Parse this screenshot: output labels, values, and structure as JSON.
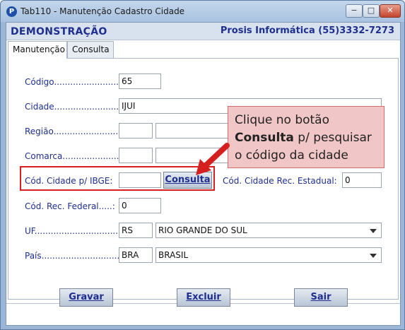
{
  "window": {
    "title": "Tab110 - Manutenção Cadastro Cidade",
    "app_icon_letter": "P",
    "controls": {
      "minimize": "−",
      "maximize": "□",
      "close": "✕"
    }
  },
  "header": {
    "left": "DEMONSTRAÇÃO",
    "right": "Prosis Informática (55)3332-7273"
  },
  "tabs": [
    {
      "label": "Manutenção",
      "active": true
    },
    {
      "label": "Consulta",
      "active": false
    }
  ],
  "form": {
    "codigo": {
      "label": "Código.........................:",
      "value": "65"
    },
    "cidade": {
      "label": "Cidade...........................:",
      "value": "IJUI"
    },
    "regiao": {
      "label": "Região...........................:",
      "value": "",
      "desc": ""
    },
    "comarca": {
      "label": "Comarca.......................:",
      "value": "",
      "desc": ""
    },
    "ibge": {
      "label": "Cód. Cidade p/ IBGE:",
      "value": "",
      "button": "Consulta"
    },
    "rec_estadual": {
      "label": "Cód. Cidade Rec. Estadual:",
      "value": "0"
    },
    "rec_federal": {
      "label": "Cód. Rec. Federal.....:",
      "value": "0"
    },
    "uf": {
      "label": "UF..................................:",
      "code": "RS",
      "name": "RIO GRANDE DO SUL"
    },
    "pais": {
      "label": "País...............................:",
      "code": "BRA",
      "name": "BRASIL"
    }
  },
  "buttons": {
    "gravar": "Gravar",
    "excluir": "Excluir",
    "sair": "Sair"
  },
  "callout": {
    "line1": "Clique no botão",
    "bold": "Consulta",
    "line2_rest": " p/ pesquisar",
    "line3": "o código da cidade"
  },
  "colors": {
    "label_blue": "#1f2f8f",
    "highlight_red": "#d6201f",
    "callout_bg": "#f1c6c6",
    "window_frame": "#9bb6d6"
  }
}
